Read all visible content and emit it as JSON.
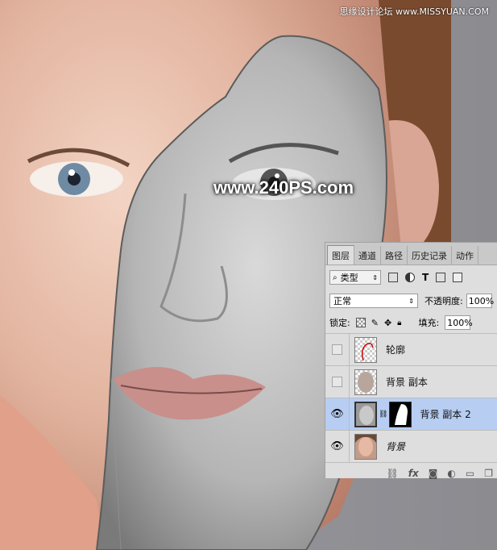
{
  "watermark_top": "思缘设计论坛 www.MISSYUAN.COM",
  "watermark_mid": "www.240PS.com",
  "layers_panel": {
    "tabs": [
      "图层",
      "通道",
      "路径",
      "历史记录",
      "动作"
    ],
    "kind_label": "类型",
    "blend_mode": "正常",
    "opacity_label": "不透明度:",
    "opacity_value": "100%",
    "lock_label": "锁定:",
    "fill_label": "填充:",
    "fill_value": "100%",
    "layers": [
      {
        "name": "轮廓",
        "visible": false,
        "selected": false
      },
      {
        "name": "背景 副本",
        "visible": false,
        "selected": false
      },
      {
        "name": "背景 副本 2",
        "visible": true,
        "selected": true
      },
      {
        "name": "背景",
        "visible": true,
        "selected": false
      }
    ]
  }
}
